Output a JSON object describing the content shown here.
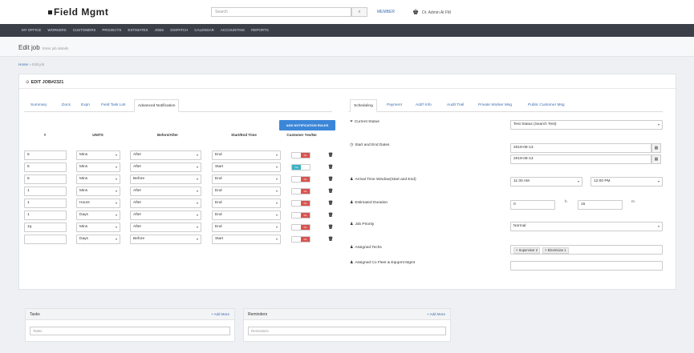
{
  "app": {
    "logo": "Field Mgmt",
    "search_placeholder": "Search",
    "member_link": "MEMBER",
    "user_name": "Dr. Admin Al FM"
  },
  "nav": [
    "MY OFFICE",
    "WORKERS",
    "CUSTOMERS",
    "PROJECTS",
    "ESTIMATES",
    "JOBS",
    "DISPATCH",
    "CALENDAR",
    "ACCOUNTING",
    "REPORTS"
  ],
  "page": {
    "title": "Edit job",
    "subtitle": "Enter job details"
  },
  "breadcrumb": {
    "home": "Home",
    "separator": "»",
    "current": "Edit job"
  },
  "card": {
    "title": "EDIT JOB#2321"
  },
  "left_tabs": [
    "Summary",
    "Docs",
    "Expn",
    "Field Task List",
    "Advanced Notification"
  ],
  "right_tabs": [
    "Scheduling",
    "Payment",
    "Add'l Info",
    "Audit Trail",
    "Private Worker Msg",
    "Public Customer Msg"
  ],
  "notif_table": {
    "headers": {
      "num": "#",
      "units": "UNITS",
      "before_after": "Before/After",
      "start_end": "Start/End Time",
      "customer": "Customer Yes/No"
    },
    "add_button": "ADD NOTIFICATION RULES",
    "rows": [
      {
        "num": "5",
        "units": "Mins",
        "before_after": "After",
        "start_end": "End",
        "customer": "No"
      },
      {
        "num": "5",
        "units": "Mins",
        "before_after": "After",
        "start_end": "Start",
        "customer": "Yes"
      },
      {
        "num": "5",
        "units": "Mins",
        "before_after": "Before",
        "start_end": "End",
        "customer": "No"
      },
      {
        "num": "1",
        "units": "Mins",
        "before_after": "After",
        "start_end": "End",
        "customer": "No"
      },
      {
        "num": "1",
        "units": "Hours",
        "before_after": "After",
        "start_end": "End",
        "customer": "No"
      },
      {
        "num": "1",
        "units": "Days",
        "before_after": "After",
        "start_end": "End",
        "customer": "No"
      },
      {
        "num": "1q",
        "units": "Mins",
        "before_after": "After",
        "start_end": "End",
        "customer": "No"
      },
      {
        "num": "",
        "units": "Days",
        "before_after": "Before",
        "start_end": "Start",
        "customer": "No"
      }
    ]
  },
  "scheduling": {
    "current_status_label": "Current Status",
    "current_status_value": "Test Status (Search Test)",
    "dates_label": "Start and End Dates",
    "start_date": "2019-08-13",
    "end_date": "2019-08-13",
    "arrival_label": "Arrival Time Window(Start and End)",
    "arrival_start": "11:30 AM",
    "arrival_end": "12:00 PM",
    "duration_label": "Estimated Duration",
    "duration_hours": "0",
    "duration_hours_unit": "h",
    "duration_minutes": "15",
    "duration_minutes_unit": "m",
    "priority_label": "Job Priority",
    "priority_value": "Normal",
    "techs_label": "Assigned Techs",
    "techs": [
      "× Supervisor 2",
      "× Electrician 1"
    ],
    "fleet_label": "Assigned Co Fleet & Equpmt Mgmt"
  },
  "tasks_panel": {
    "title": "Tasks",
    "add": "+ Add More",
    "placeholder": "Tasks"
  },
  "reminders_panel": {
    "title": "Reminders",
    "add": "+ Add More",
    "placeholder": "Reminders"
  }
}
